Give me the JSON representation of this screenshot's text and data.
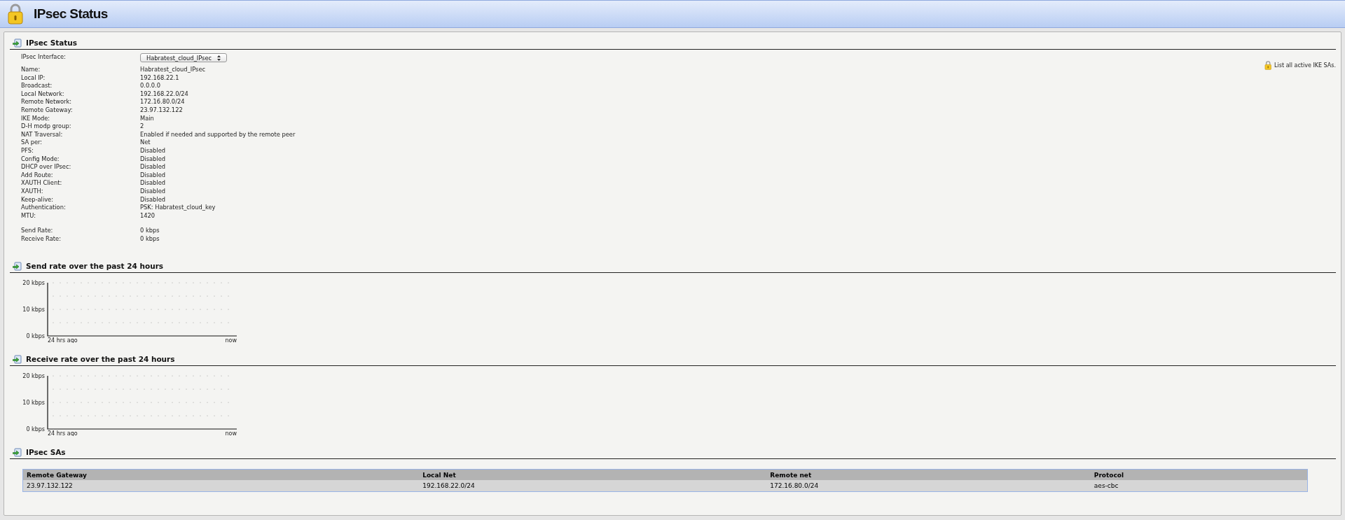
{
  "header": {
    "title": "IPsec Status"
  },
  "status": {
    "title": "IPsec Status",
    "interface_label": "IPsec Interface:",
    "interface_value": "Habratest_cloud_IPsec",
    "ike_link": "List all active IKE SAs.",
    "details": [
      {
        "label": "Name:",
        "value": "Habratest_cloud_IPsec"
      },
      {
        "label": "Local IP:",
        "value": "192.168.22.1"
      },
      {
        "label": "Broadcast:",
        "value": "0.0.0.0"
      },
      {
        "label": "Local Network:",
        "value": "192.168.22.0/24"
      },
      {
        "label": "Remote Network:",
        "value": "172.16.80.0/24"
      },
      {
        "label": "Remote Gateway:",
        "value": "23.97.132.122"
      },
      {
        "label": "IKE Mode:",
        "value": "Main"
      },
      {
        "label": "D-H modp group:",
        "value": "2"
      },
      {
        "label": "NAT Traversal:",
        "value": "Enabled if needed and supported by the remote peer"
      },
      {
        "label": "SA per:",
        "value": "Net"
      },
      {
        "label": "PFS:",
        "value": "Disabled"
      },
      {
        "label": "Config Mode:",
        "value": "Disabled"
      },
      {
        "label": "DHCP over IPsec:",
        "value": "Disabled"
      },
      {
        "label": "Add Route:",
        "value": "Disabled"
      },
      {
        "label": "XAUTH Client:",
        "value": "Disabled"
      },
      {
        "label": "XAUTH:",
        "value": "Disabled"
      },
      {
        "label": "Keep-alive:",
        "value": "Disabled"
      },
      {
        "label": "Authentication:",
        "value": "PSK: Habratest_cloud_key"
      },
      {
        "label": "MTU:",
        "value": "1420"
      }
    ],
    "rates": [
      {
        "label": "Send Rate:",
        "value": "0 kbps"
      },
      {
        "label": "Receive Rate:",
        "value": "0 kbps"
      }
    ]
  },
  "charts": [
    {
      "title": "Send rate over the past 24 hours",
      "chart_data": {
        "type": "line",
        "ylim": [
          0,
          20
        ],
        "yticks": [
          {
            "value": 0,
            "label": "0 kbps"
          },
          {
            "value": 10,
            "label": "10 kbps"
          },
          {
            "value": 20,
            "label": "20 kbps"
          }
        ],
        "categories": [
          "24 hrs ago",
          "now"
        ]
      }
    },
    {
      "title": "Receive rate over the past 24 hours",
      "chart_data": {
        "type": "line",
        "ylim": [
          0,
          20
        ],
        "yticks": [
          {
            "value": 0,
            "label": "0 kbps"
          },
          {
            "value": 10,
            "label": "10 kbps"
          },
          {
            "value": 20,
            "label": "20 kbps"
          }
        ],
        "categories": [
          "24 hrs ago",
          "now"
        ]
      }
    }
  ],
  "sas": {
    "title": "IPsec SAs",
    "columns": [
      "Remote Gateway",
      "Local Net",
      "Remote net",
      "Protocol"
    ],
    "rows": [
      [
        "23.97.132.122",
        "192.168.22.0/24",
        "172.16.80.0/24",
        "aes-cbc"
      ]
    ]
  }
}
